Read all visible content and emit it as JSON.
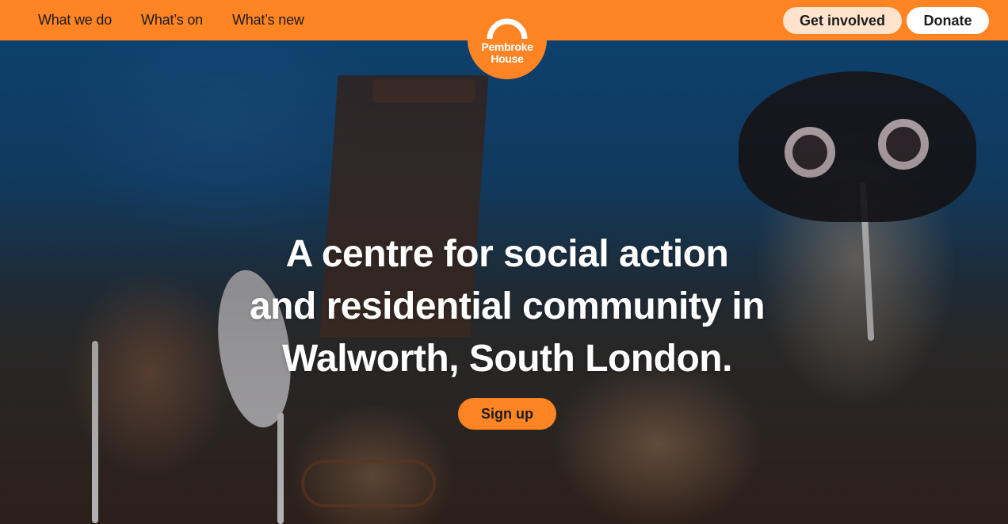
{
  "nav": {
    "links": [
      {
        "label": "What we do"
      },
      {
        "label": "What’s on"
      },
      {
        "label": "What’s new"
      }
    ],
    "get_involved": "Get involved",
    "donate": "Donate"
  },
  "logo": {
    "line1": "Pembroke",
    "line2": "House"
  },
  "hero": {
    "headline_lines": [
      "A centre for social action",
      "and residential community in",
      "Walworth, South London."
    ],
    "cta": "Sign up"
  },
  "colors": {
    "brand_orange": "#ff8424",
    "pill_light": "#ffe3cc",
    "text_dark": "#1c1c1c"
  }
}
